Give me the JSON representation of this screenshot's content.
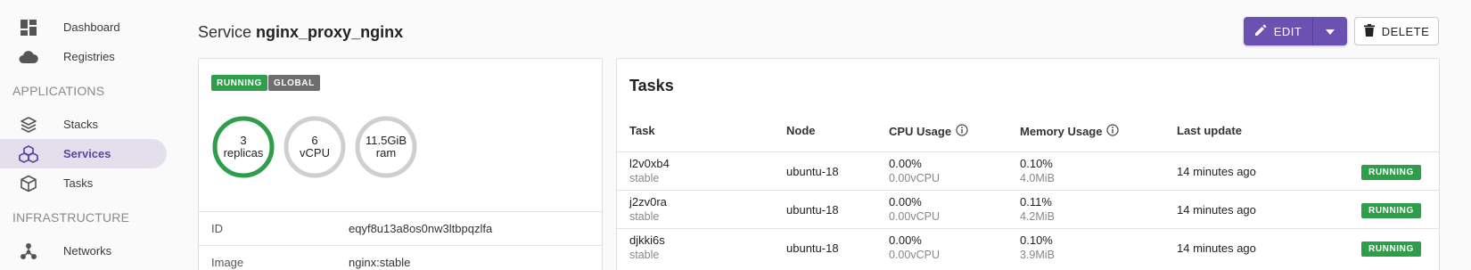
{
  "sidebar": {
    "items_top": [
      {
        "label": "Dashboard",
        "icon": "dashboard-icon"
      },
      {
        "label": "Registries",
        "icon": "cloud-icon"
      }
    ],
    "applications_title": "APPLICATIONS",
    "applications": [
      {
        "label": "Stacks",
        "icon": "stacks-icon"
      },
      {
        "label": "Services",
        "icon": "services-icon",
        "active": true
      },
      {
        "label": "Tasks",
        "icon": "tasks-icon"
      }
    ],
    "infrastructure_title": "INFRASTRUCTURE",
    "infrastructure": [
      {
        "label": "Networks",
        "icon": "networks-icon"
      }
    ]
  },
  "header": {
    "title_prefix": "Service",
    "title_name": "nginx_proxy_nginx",
    "edit_label": "EDIT",
    "delete_label": "DELETE"
  },
  "service": {
    "badges": [
      "RUNNING",
      "GLOBAL"
    ],
    "gauges": [
      {
        "line1": "3",
        "line2": "replicas",
        "fill": 1.0
      },
      {
        "line1": "6",
        "line2": "vCPU",
        "fill": 0.0
      },
      {
        "line1": "11.5GiB",
        "line2": "ram",
        "fill": 0.0
      }
    ],
    "details": [
      {
        "key": "ID",
        "value": "eqyf8u13a8os0nw3ltbpqzlfa"
      },
      {
        "key": "Image",
        "value": "nginx:stable"
      }
    ]
  },
  "tasks": {
    "title": "Tasks",
    "columns": [
      "Task",
      "Node",
      "CPU Usage",
      "Memory Usage",
      "Last update"
    ],
    "rows": [
      {
        "task": "l2v0xb4",
        "tag": "stable",
        "node": "ubuntu-18",
        "cpu": "0.00%",
        "cpu_sub": "0.00vCPU",
        "mem": "0.10%",
        "mem_sub": "4.0MiB",
        "updated": "14 minutes ago",
        "status": "RUNNING"
      },
      {
        "task": "j2zv0ra",
        "tag": "stable",
        "node": "ubuntu-18",
        "cpu": "0.00%",
        "cpu_sub": "0.00vCPU",
        "mem": "0.11%",
        "mem_sub": "4.2MiB",
        "updated": "14 minutes ago",
        "status": "RUNNING"
      },
      {
        "task": "djkki6s",
        "tag": "stable",
        "node": "ubuntu-18",
        "cpu": "0.00%",
        "cpu_sub": "0.00vCPU",
        "mem": "0.10%",
        "mem_sub": "3.9MiB",
        "updated": "14 minutes ago",
        "status": "RUNNING"
      }
    ]
  },
  "colors": {
    "accent": "#6a51b2",
    "running": "#2e9e4b",
    "global": "#6e6e6e",
    "active_bg": "#e3e0ec",
    "gauge_track": "#cfcfcf"
  }
}
